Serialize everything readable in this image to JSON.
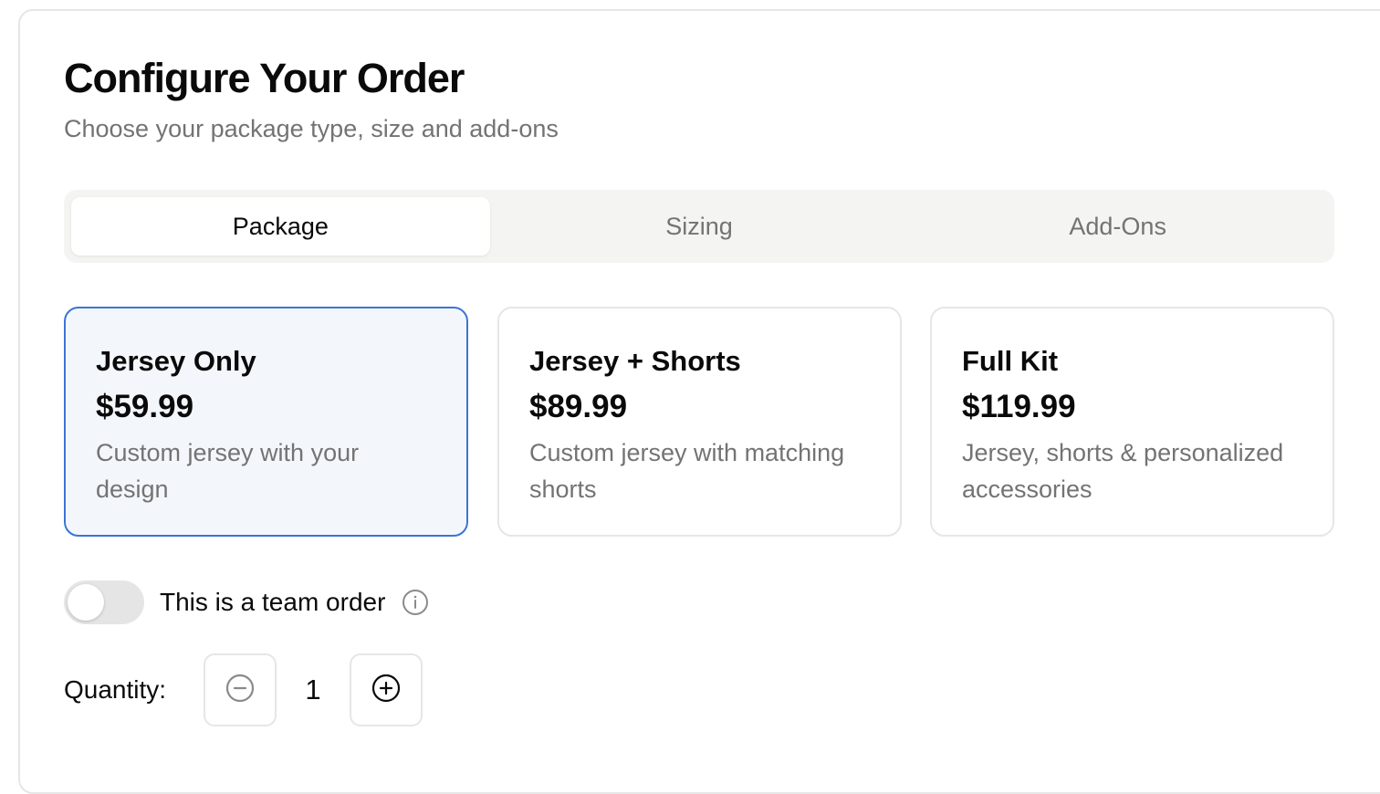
{
  "header": {
    "title": "Configure Your Order",
    "subtitle": "Choose your package type, size and add-ons"
  },
  "tabs": [
    {
      "label": "Package",
      "active": true
    },
    {
      "label": "Sizing",
      "active": false
    },
    {
      "label": "Add-Ons",
      "active": false
    }
  ],
  "packages": [
    {
      "name": "Jersey Only",
      "price": "$59.99",
      "description": "Custom jersey with your design",
      "selected": true
    },
    {
      "name": "Jersey + Shorts",
      "price": "$89.99",
      "description": "Custom jersey with matching shorts",
      "selected": false
    },
    {
      "name": "Full Kit",
      "price": "$119.99",
      "description": "Jersey, shorts & personalized accessories",
      "selected": false
    }
  ],
  "team_order": {
    "label": "This is a team order",
    "enabled": false,
    "icon": "info-icon"
  },
  "quantity": {
    "label": "Quantity:",
    "value": "1",
    "decrement_icon": "minus-circle-icon",
    "increment_icon": "plus-circle-icon"
  },
  "colors": {
    "selected_border": "#3b74d6",
    "selected_background": "#f3f7fc",
    "muted_text": "#737373",
    "tab_track": "#f4f4f2",
    "toggle_off": "#e5e5e5"
  }
}
